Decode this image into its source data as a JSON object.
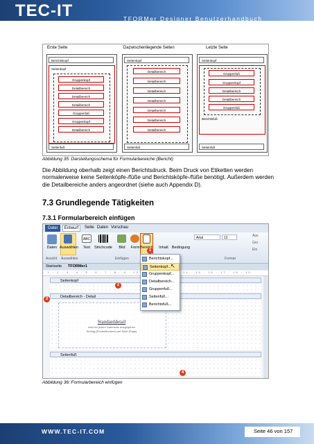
{
  "header": {
    "logo": "TEC-IT",
    "title": "TFORMer Designer Benutzerhandbuch"
  },
  "figure1": {
    "columns": [
      "Erste Seite",
      "Dazwischenliegende Seiten",
      "Letzte Seite"
    ],
    "col1": {
      "berichtskopf": "Berichtskopf",
      "seitenkopf": "Seitenkopf",
      "gruppenkopf1": "Gruppenkopf",
      "detail1": "Detailbereich",
      "detail2": "Detailbereich",
      "detail3": "Detailbereich",
      "gruppenfuss": "Gruppenfuß",
      "gruppenkopf2": "Gruppenkopf",
      "detail4": "Detailbereich",
      "seitenfuss": "Seitenfuß"
    },
    "col2": {
      "seitenkopf": "Seitenkopf",
      "details": [
        "Detailbereich",
        "Detailbereich",
        "Detailbereich",
        "Detailbereich",
        "Detailbereich",
        "Detailbereich",
        "Detailbereich"
      ],
      "seitenfuss": "Seitenfuß"
    },
    "col3": {
      "seitenkopf": "Seitenkopf",
      "gruppenfuss1": "Gruppenfuß",
      "gruppenkopf": "Gruppenkopf",
      "detail1": "Detailbereich",
      "detail2": "Detailbereich",
      "gruppenfuss2": "Gruppenfuß",
      "berichtsfuss": "Berichtsfuß",
      "seitenfuss": "Seitenfuß"
    },
    "caption": "Abbildung 35: Darstellungsschema für Formularbereiche (Bericht)"
  },
  "paragraph": "Die Abbildung oberhalb zeigt einen Berichtsdruck. Beim Druck von Etiketten werden normalerweise keine Seitenköpfe-/füße und Berichtsköpfe-/füße benötigt. Außerdem werden die Detailbereiche anders angeordnet (siehe auch Appendix D).",
  "heading2": "7.3 Grundlegende Tätigkeiten",
  "heading3": "7.3.1 Formularbereich einfügen",
  "screenshot": {
    "tabs": [
      "Datei",
      "Entwurf",
      "Seite",
      "Daten",
      "Vorschau"
    ],
    "ribbon_buttons": [
      "Daten",
      "Auswählen",
      "Text",
      "Strichcode",
      "Bild",
      "Form",
      "Bereich",
      "Inhalt",
      "Bedingung"
    ],
    "groups": [
      "Ansicht",
      "Auswählen",
      "Einfügen",
      "Format"
    ],
    "font_name": "Arial",
    "font_size": "12",
    "doc_tabs": [
      "Startseite",
      "TFORMer1"
    ],
    "menu_items": [
      "Berichtskopf...",
      "Seitenkopf...",
      "Gruppenkopf...",
      "Detailbereich...",
      "Gruppenfuß...",
      "Seitenfuß...",
      "Berichtsfuß..."
    ],
    "sections": [
      "Seitenkopf",
      "Detailbereich - Detail",
      "Seitenfuß"
    ],
    "placeholder_title": "Standarddetail",
    "placeholder_line1": "wird bei jedem Datensatz ausgegeben",
    "placeholder_line2": "Eintrag [Printerfilename] auf Seite [Page]",
    "badges": [
      "1",
      "2",
      "3",
      "4"
    ],
    "right_buttons": [
      "Aus",
      "Gro",
      "Ein"
    ]
  },
  "caption2": "Abbildung 36: Formularbereich einfügen",
  "footer": {
    "url": "WWW.TEC-IT.COM",
    "page": "Seite 46 von 157"
  }
}
